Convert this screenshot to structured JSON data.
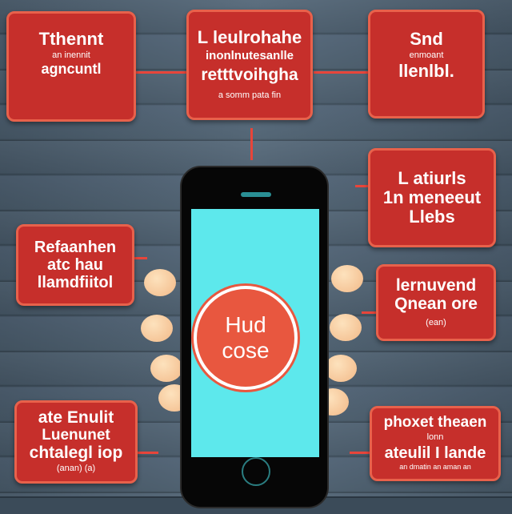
{
  "center": {
    "line1": "Hud",
    "line2": "cose"
  },
  "boxes": {
    "top_left": {
      "l1": "Tthennt",
      "l2": "an inennit",
      "l3": "agncuntl"
    },
    "top_center": {
      "l1": "L leulrohahe",
      "l2": "inonlnutesanlle",
      "l3": "retttvoihgha",
      "l4": "a somm pata fin"
    },
    "top_right": {
      "l1": "Snd",
      "l2": "enmoant",
      "l3": "llenlbl."
    },
    "right_1": {
      "l1": "L atiurls",
      "l2": "1n meneeut",
      "l3": "Llebs"
    },
    "left_1": {
      "l1": "Refaanhen",
      "l2": "atc hau",
      "l3": "llamdfiitol"
    },
    "right_2": {
      "l1": "lernuvend",
      "l2": "Qnean ore",
      "l3": "(ean)"
    },
    "left_2": {
      "l1": "ate Enulit",
      "l2": "Luenunet",
      "l3": "chtalegl iop",
      "l4": "(anan) (a)"
    },
    "right_3": {
      "l1": "phoxet theaen",
      "l2": "lonn",
      "l3": "ateulil I lande",
      "l4": "an dmatin an aman an"
    }
  },
  "colors": {
    "box": "#c62f2b",
    "screen": "#5de8ec",
    "accent": "#e8573f",
    "background": "#4b5d6d"
  }
}
